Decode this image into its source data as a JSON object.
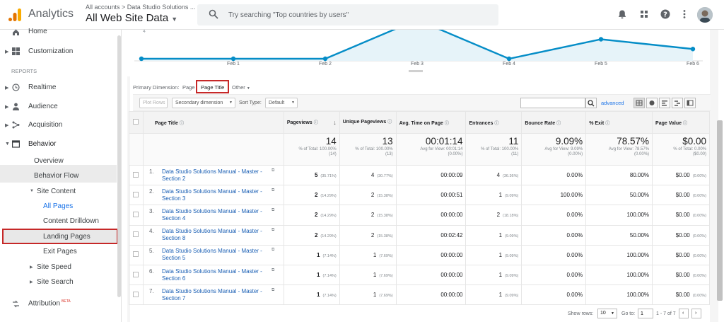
{
  "topbar": {
    "app_name": "Analytics",
    "account_crumb": "All accounts > Data Studio Solutions ...",
    "view_name": "All Web Site Data",
    "search_placeholder": "Try searching \"Top countries by users\""
  },
  "sidebar": {
    "home": "Home",
    "customization": "Customization",
    "reports_header": "REPORTS",
    "realtime": "Realtime",
    "audience": "Audience",
    "acquisition": "Acquisition",
    "behavior": "Behavior",
    "overview": "Overview",
    "behavior_flow": "Behavior Flow",
    "site_content": "Site Content",
    "all_pages": "All Pages",
    "content_drilldown": "Content Drilldown",
    "landing_pages": "Landing Pages",
    "exit_pages": "Exit Pages",
    "site_speed": "Site Speed",
    "site_search": "Site Search",
    "attribution": "Attribution",
    "attribution_badge": "BETA"
  },
  "chart_data": {
    "type": "area",
    "x": [
      "",
      "Feb 1",
      "Feb 2",
      "Feb 3",
      "Feb 4",
      "Feb 5",
      "Feb 6"
    ],
    "values": [
      0,
      0,
      0,
      4,
      0,
      2,
      1
    ],
    "top_tick_label": "4",
    "series_color": "#058dc7",
    "fill_color": "#e6f3f9"
  },
  "dimension_row": {
    "label": "Primary Dimension:",
    "page": "Page",
    "page_title": "Page Title",
    "other": "Other"
  },
  "controls": {
    "plot_rows": "Plot Rows",
    "secondary_dimension": "Secondary dimension",
    "sort_type_label": "Sort Type:",
    "sort_type_value": "Default",
    "advanced": "advanced"
  },
  "table": {
    "headers": [
      "Page Title",
      "Pageviews",
      "Unique Pageviews",
      "Avg. Time on Page",
      "Entrances",
      "Bounce Rate",
      "% Exit",
      "Page Value"
    ],
    "totals": [
      {
        "value": "14",
        "sub1": "% of Total: 100.00%",
        "sub2": "(14)"
      },
      {
        "value": "13",
        "sub1": "% of Total: 100.00%",
        "sub2": "(13)"
      },
      {
        "value": "00:01:14",
        "sub1": "Avg for View: 00:01:14",
        "sub2": "(0.00%)"
      },
      {
        "value": "11",
        "sub1": "% of Total: 100.00%",
        "sub2": "(11)"
      },
      {
        "value": "9.09%",
        "sub1": "Avg for View: 9.09%",
        "sub2": "(0.00%)"
      },
      {
        "value": "78.57%",
        "sub1": "Avg for View: 78.57%",
        "sub2": "(0.00%)"
      },
      {
        "value": "$0.00",
        "sub1": "% of Total: 0.00%",
        "sub2": "($0.00)"
      }
    ],
    "rows": [
      {
        "idx": "1.",
        "title": "Data Studio Solutions Manual - Master - Section 2",
        "pv": "5",
        "pv_pct": "(35.71%)",
        "upv": "4",
        "upv_pct": "(30.77%)",
        "time": "00:00:09",
        "ent": "4",
        "ent_pct": "(36.36%)",
        "bounce": "0.00%",
        "exit": "80.00%",
        "value": "$0.00",
        "value_pct": "(0.00%)"
      },
      {
        "idx": "2.",
        "title": "Data Studio Solutions Manual - Master - Section 3",
        "pv": "2",
        "pv_pct": "(14.29%)",
        "upv": "2",
        "upv_pct": "(15.38%)",
        "time": "00:00:51",
        "ent": "1",
        "ent_pct": "(9.09%)",
        "bounce": "100.00%",
        "exit": "50.00%",
        "value": "$0.00",
        "value_pct": "(0.00%)"
      },
      {
        "idx": "3.",
        "title": "Data Studio Solutions Manual - Master - Section 4",
        "pv": "2",
        "pv_pct": "(14.29%)",
        "upv": "2",
        "upv_pct": "(15.38%)",
        "time": "00:00:00",
        "ent": "2",
        "ent_pct": "(18.18%)",
        "bounce": "0.00%",
        "exit": "100.00%",
        "value": "$0.00",
        "value_pct": "(0.00%)"
      },
      {
        "idx": "4.",
        "title": "Data Studio Solutions Manual - Master - Section 8",
        "pv": "2",
        "pv_pct": "(14.29%)",
        "upv": "2",
        "upv_pct": "(15.38%)",
        "time": "00:02:42",
        "ent": "1",
        "ent_pct": "(9.09%)",
        "bounce": "0.00%",
        "exit": "50.00%",
        "value": "$0.00",
        "value_pct": "(0.00%)"
      },
      {
        "idx": "5.",
        "title": "Data Studio Solutions Manual - Master - Section 5",
        "pv": "1",
        "pv_pct": "(7.14%)",
        "upv": "1",
        "upv_pct": "(7.69%)",
        "time": "00:00:00",
        "ent": "1",
        "ent_pct": "(9.09%)",
        "bounce": "0.00%",
        "exit": "100.00%",
        "value": "$0.00",
        "value_pct": "(0.00%)"
      },
      {
        "idx": "6.",
        "title": "Data Studio Solutions Manual - Master - Section 6",
        "pv": "1",
        "pv_pct": "(7.14%)",
        "upv": "1",
        "upv_pct": "(7.69%)",
        "time": "00:00:00",
        "ent": "1",
        "ent_pct": "(9.09%)",
        "bounce": "0.00%",
        "exit": "100.00%",
        "value": "$0.00",
        "value_pct": "(0.00%)"
      },
      {
        "idx": "7.",
        "title": "Data Studio Solutions Manual - Master - Section 7",
        "pv": "1",
        "pv_pct": "(7.14%)",
        "upv": "1",
        "upv_pct": "(7.69%)",
        "time": "00:00:00",
        "ent": "1",
        "ent_pct": "(9.09%)",
        "bounce": "0.00%",
        "exit": "100.00%",
        "value": "$0.00",
        "value_pct": "(0.00%)"
      }
    ]
  },
  "pager": {
    "show_rows_label": "Show rows:",
    "show_rows_value": "10",
    "goto_label": "Go to:",
    "goto_value": "1",
    "range": "1 - 7 of 7"
  },
  "colors": {
    "accent": "#1a73e8",
    "highlight_box": "#c62828",
    "logo_orange": "#f9ab00",
    "logo_dark_orange": "#e37400"
  }
}
